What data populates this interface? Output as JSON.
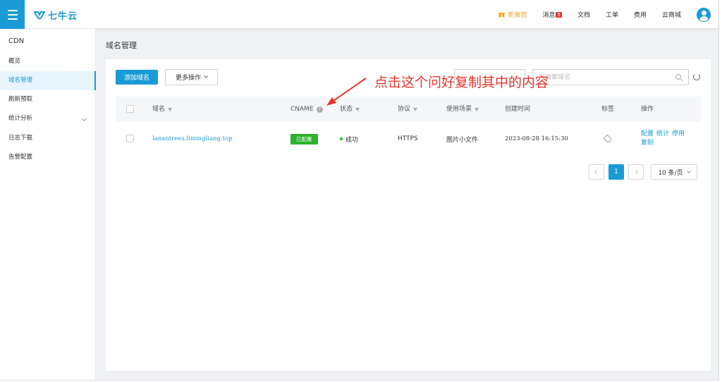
{
  "header": {
    "logo_text": "七牛云",
    "nav": [
      {
        "label": "新推官",
        "icon": "gift-icon"
      },
      {
        "label": "消息",
        "badge": "5"
      },
      {
        "label": "文档"
      },
      {
        "label": "工单"
      },
      {
        "label": "费用"
      },
      {
        "label": "云商城"
      }
    ]
  },
  "sidebar": {
    "title": "CDN",
    "items": [
      {
        "label": "概览"
      },
      {
        "label": "域名管理",
        "active": true
      },
      {
        "label": "刷新预取"
      },
      {
        "label": "统计分析",
        "expandable": true
      },
      {
        "label": "日志下载"
      },
      {
        "label": "告警配置"
      }
    ]
  },
  "main": {
    "page_title": "域名管理",
    "add_button": "添加域名",
    "more_button": "更多操作",
    "search_placeholder": "可搜索域名",
    "table": {
      "headers": [
        "域名",
        "CNAME",
        "状态",
        "协议",
        "使用场景",
        "创建时间",
        "标签",
        "操作"
      ],
      "rows": [
        {
          "domain": "lanantrees.limingliang.top",
          "cname": "已配置",
          "status": "成功",
          "protocol": "HTTPS",
          "scene": "图片小文件",
          "created": "2023-08-28 16:15:30",
          "actions": [
            "配置",
            "统计",
            "停用",
            "复制"
          ]
        }
      ]
    },
    "pagination": {
      "current": "1",
      "page_size": "10 条/页"
    }
  },
  "annotation": {
    "text": "点击这个问好复制其中的内容",
    "color": "#e8352b"
  },
  "colors": {
    "accent": "#1a9bd6",
    "success": "#2bb32b",
    "warning": "#f5a623"
  }
}
